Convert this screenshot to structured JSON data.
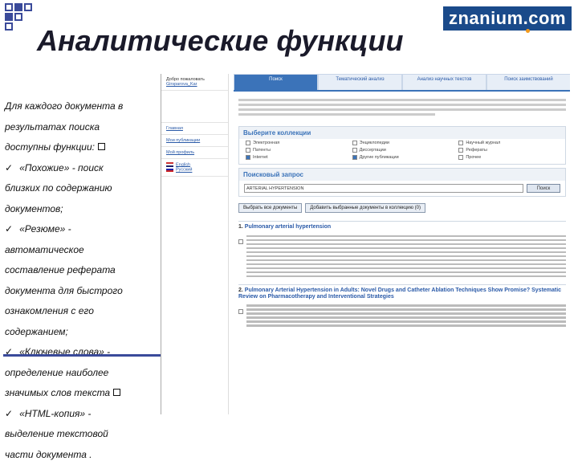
{
  "logo": "znanium.com",
  "title": "Аналитические функции",
  "bullets": [
    "Для каждого документа в",
    "результатах поиска",
    "доступны функции:",
    "«Похожие» - поиск",
    "близких по содержанию",
    "документов;",
    "«Резюме» -",
    "автоматическое",
    "составление реферата",
    "документа для быстрого",
    "ознакомления с его",
    "содержанием;",
    "«Ключевые слова» -",
    "определение наиболее",
    "значимых слов текста",
    "«HTML-копия» -",
    "выделение текстовой",
    "части документа ."
  ],
  "screen": {
    "sidebar": {
      "welcome": "Добро пожаловать",
      "user": "Girsparova_Kar",
      "links": [
        "Главная",
        "Мои публикации",
        "Мой профиль"
      ],
      "lang": [
        "English",
        "Русский"
      ]
    },
    "tabs": [
      "Поиск",
      "Тематический анализ",
      "Анализ научных текстов",
      "Поиск заимствований"
    ],
    "collections_title": "Выберите коллекции",
    "collections": [
      {
        "label": "Электронная",
        "on": false
      },
      {
        "label": "Энциклопедии",
        "on": false
      },
      {
        "label": "Научный журнал",
        "on": false
      },
      {
        "label": "Патенты",
        "on": false
      },
      {
        "label": "Диссертации",
        "on": false
      },
      {
        "label": "Рефераты",
        "on": false
      },
      {
        "label": "Internet",
        "on": true
      },
      {
        "label": "Другие публикации",
        "on": true
      },
      {
        "label": "Прочее",
        "on": false
      }
    ],
    "query_title": "Поисковый запрос",
    "query_value": "ARTERIAL HYPERTENSION",
    "search_button": "Поиск",
    "select_all": "Выбрать все документы",
    "add_selected": "Добавить выбранные документы в коллекцию (0)",
    "results": [
      {
        "num": "1.",
        "title": "Pulmonary arterial hypertension"
      },
      {
        "num": "2.",
        "title": "Pulmonary Arterial Hypertension in Adults: Novel Drugs and Catheter Ablation Techniques Show Promise? Systematic Review on Pharmacotherapy and Interventional Strategies"
      }
    ]
  }
}
